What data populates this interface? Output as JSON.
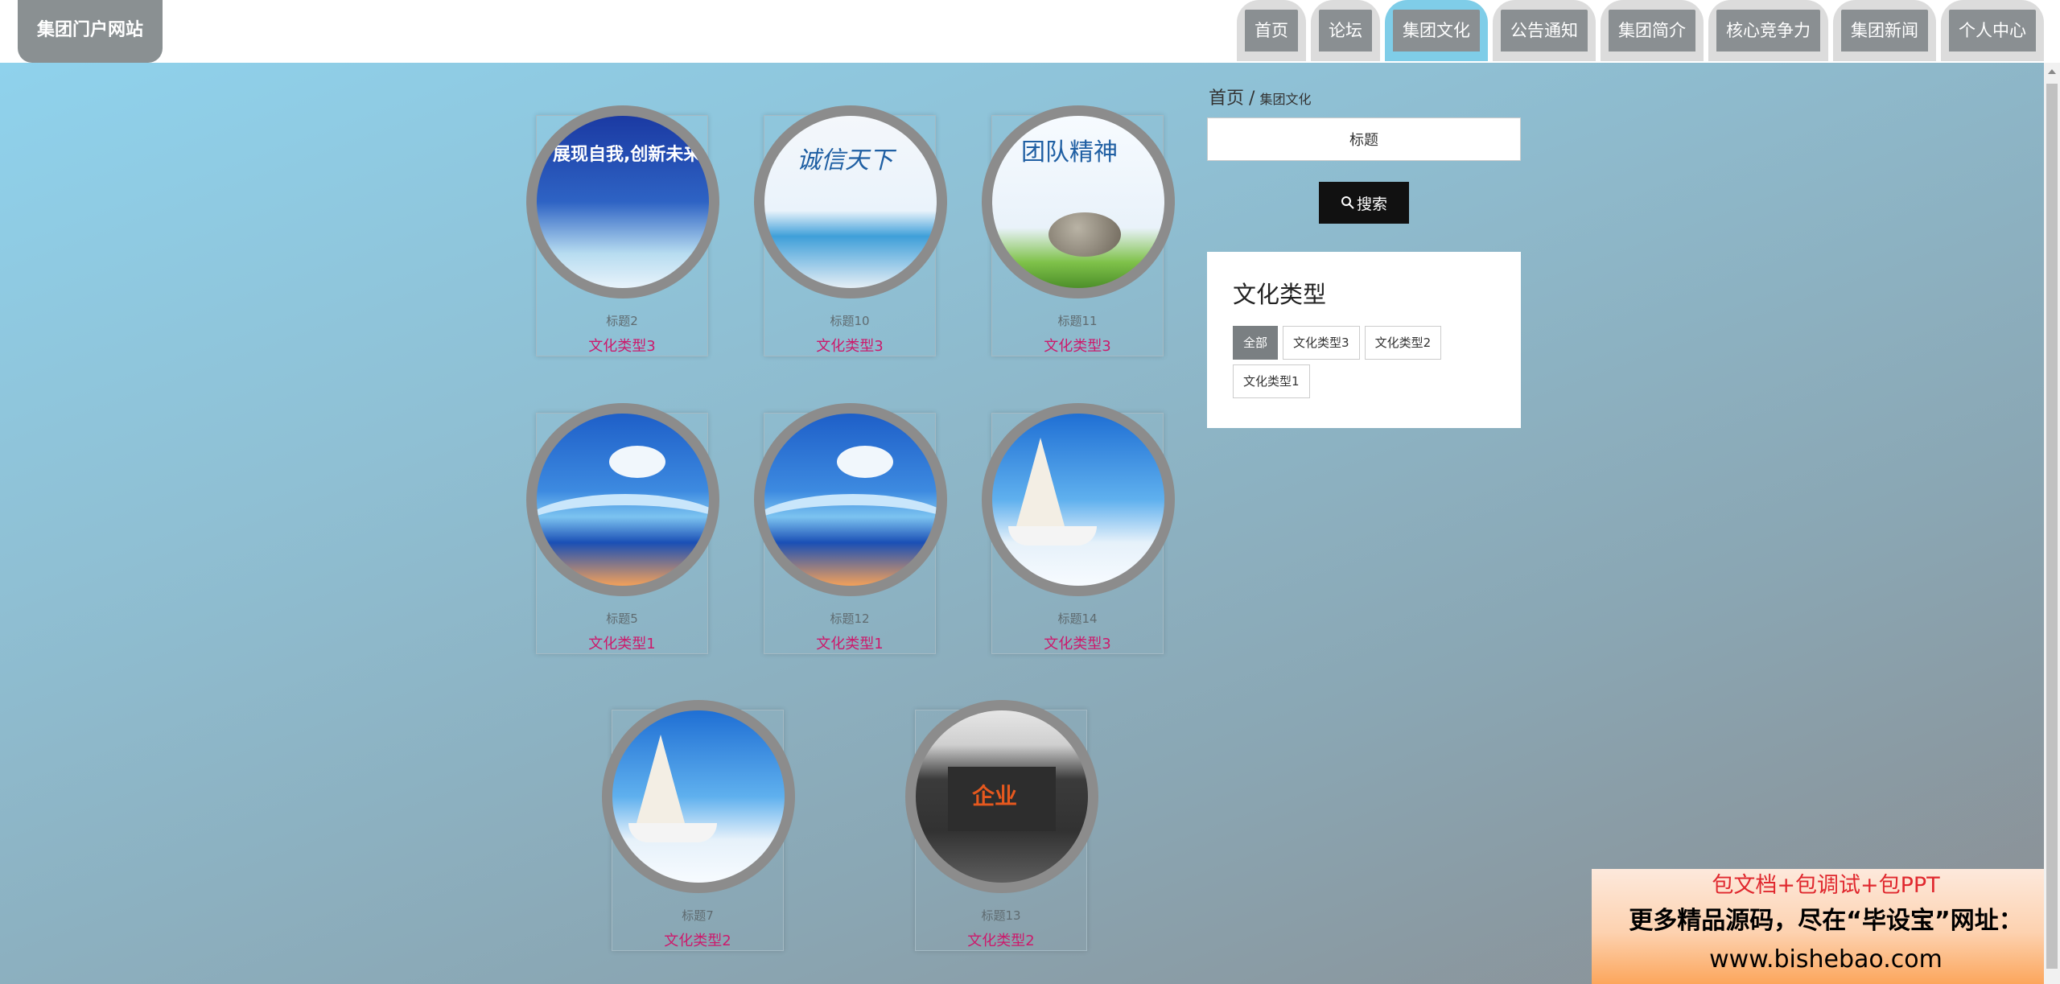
{
  "header": {
    "logo": "集团门户网站",
    "nav": [
      "首页",
      "论坛",
      "集团文化",
      "公告通知",
      "集团简介",
      "核心竞争力",
      "集团新闻",
      "个人中心"
    ],
    "active_nav": "集团文化"
  },
  "cards": [
    {
      "title": "标题2",
      "type": "文化类型3",
      "art": "art1",
      "art_text": "展现自我,创新未来"
    },
    {
      "title": "标题10",
      "type": "文化类型3",
      "art": "art2",
      "art_text": "诚信天下"
    },
    {
      "title": "标题11",
      "type": "文化类型3",
      "art": "art3",
      "art_text": "团队精神"
    },
    {
      "title": "标题5",
      "type": "文化类型1",
      "art": "art4"
    },
    {
      "title": "标题12",
      "type": "文化类型1",
      "art": "art4"
    },
    {
      "title": "标题14",
      "type": "文化类型3",
      "art": "art5"
    },
    {
      "title": "标题7",
      "type": "文化类型2",
      "art": "art5"
    },
    {
      "title": "标题13",
      "type": "文化类型2",
      "art": "art6",
      "art_text": "企业"
    }
  ],
  "breadcrumb": {
    "home": "首页",
    "separator": "/",
    "current": "集团文化"
  },
  "search": {
    "value": "标题",
    "button": "搜索"
  },
  "type_filter": {
    "heading": "文化类型",
    "tags": [
      "全部",
      "文化类型3",
      "文化类型2",
      "文化类型1"
    ],
    "active": "全部"
  },
  "ad": {
    "line1": "包文档+包调试+包PPT",
    "line2": "更多精品源码，尽在“毕设宝”网址：",
    "line3": "www.bishebao.com"
  }
}
